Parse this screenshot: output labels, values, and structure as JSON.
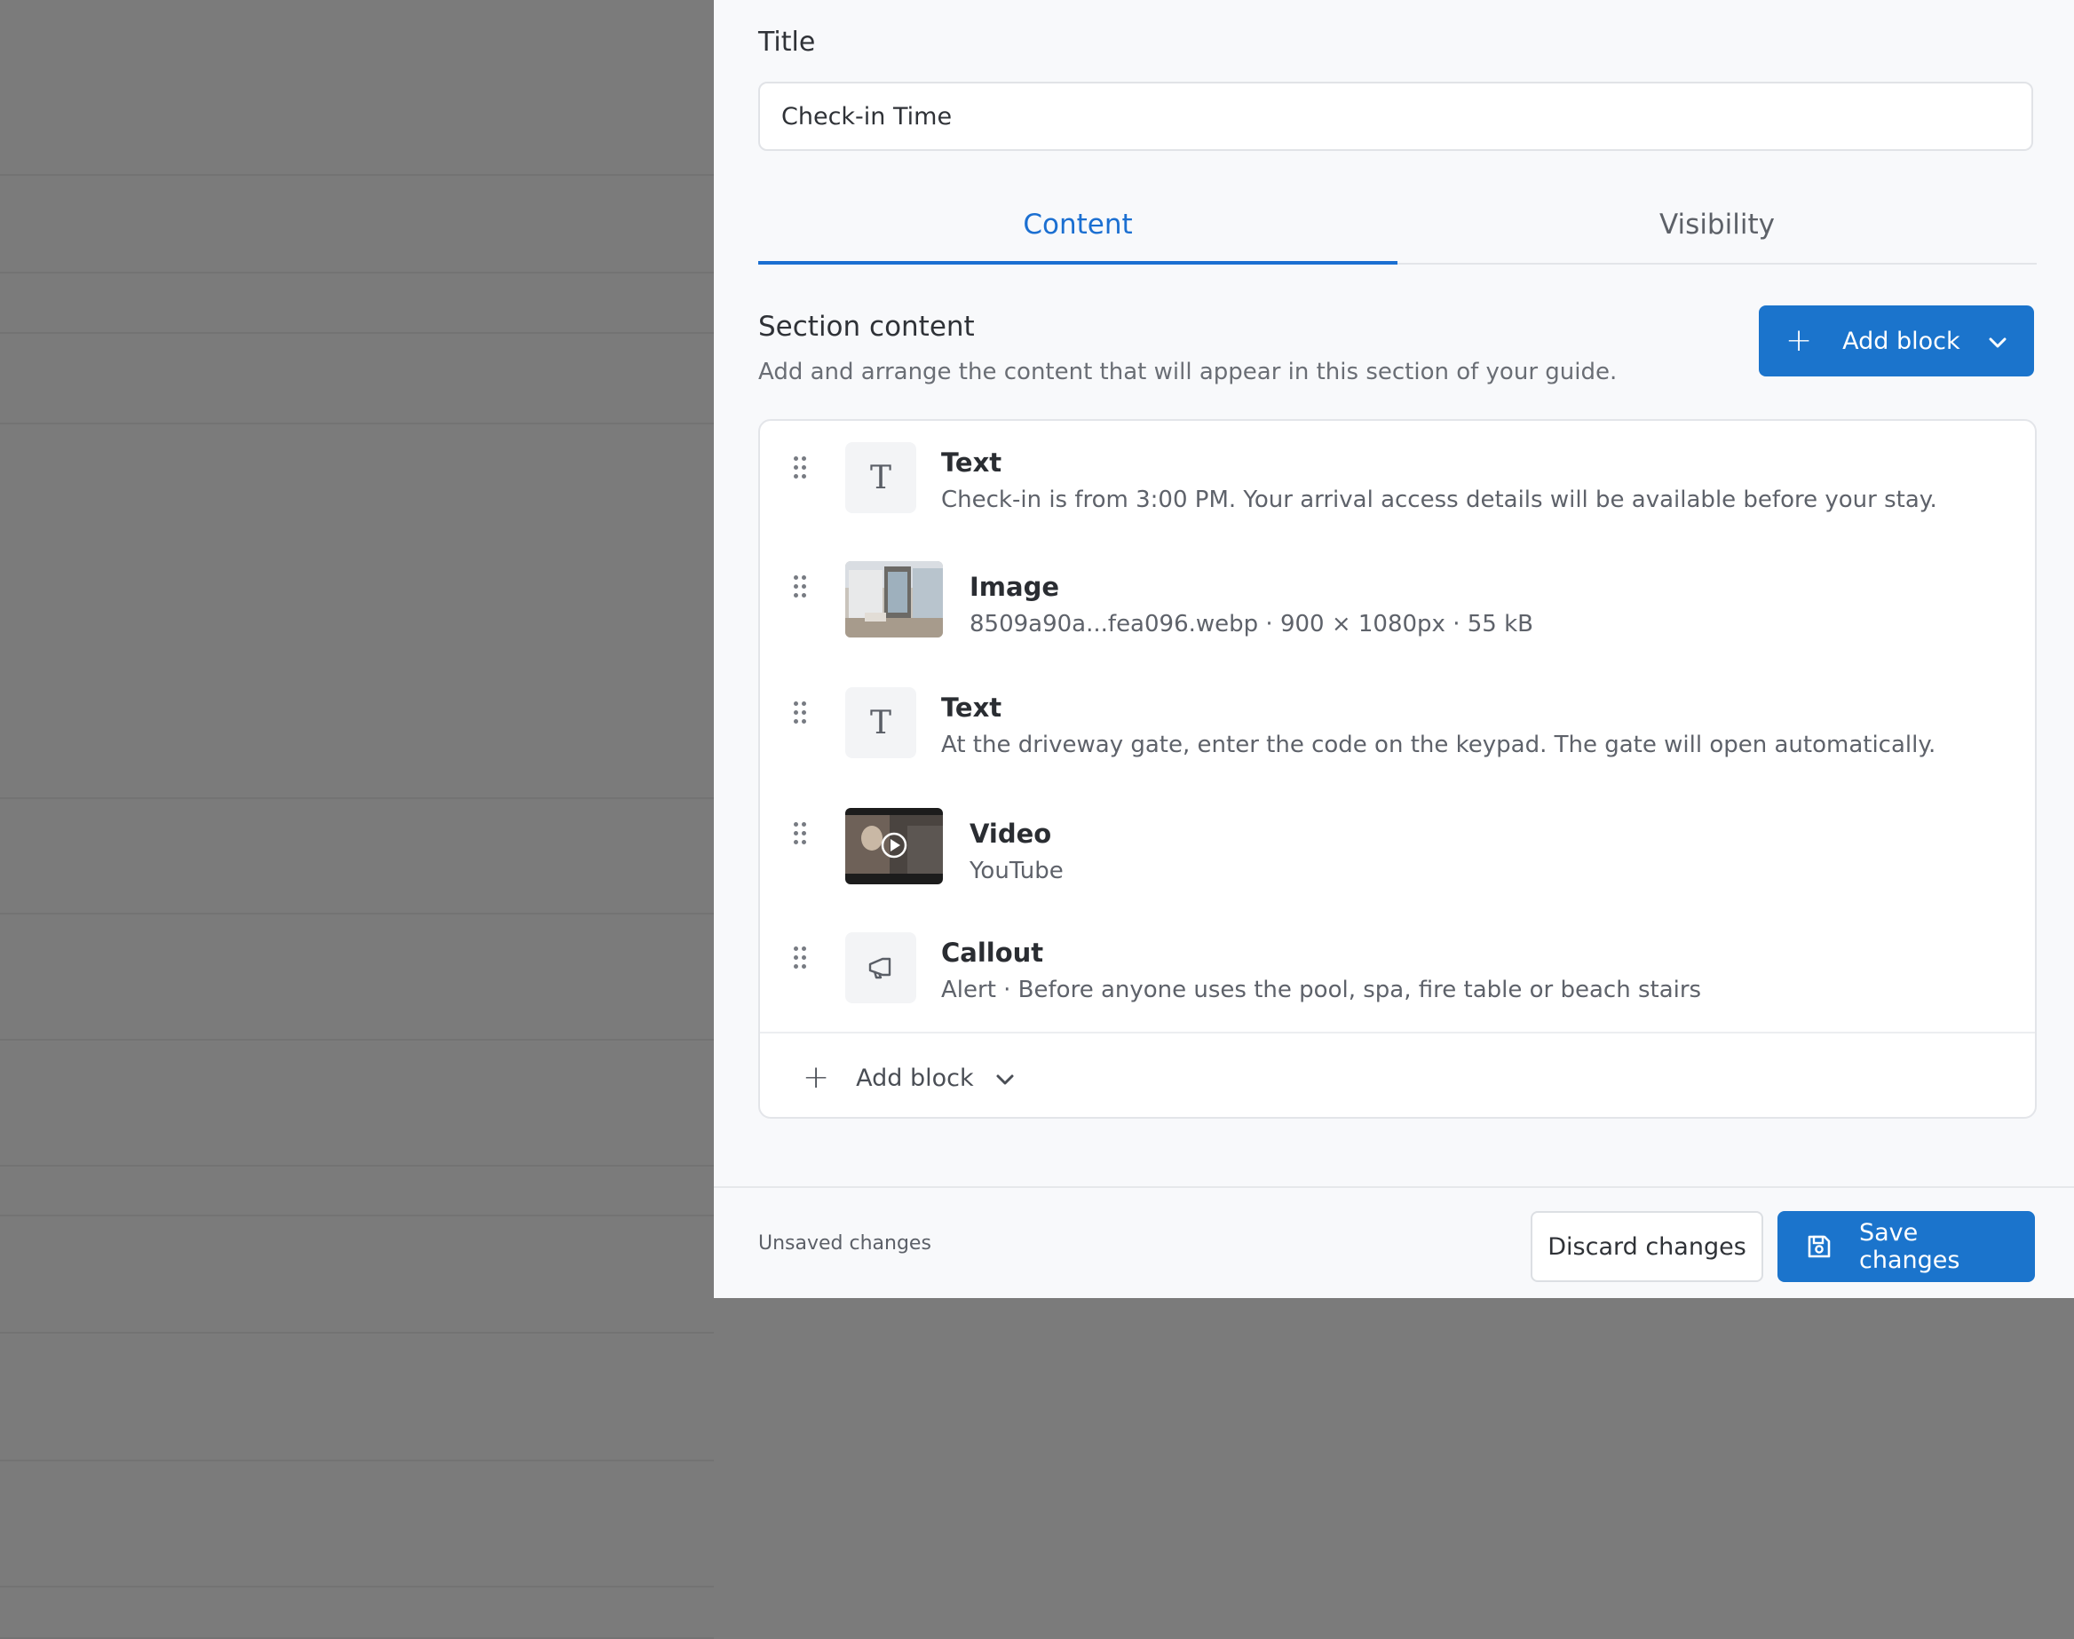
{
  "form": {
    "title_label": "Title",
    "title_value": "Check-in Time"
  },
  "tabs": [
    {
      "label": "Content",
      "active": true
    },
    {
      "label": "Visibility",
      "active": false
    }
  ],
  "section": {
    "title": "Section content",
    "description": "Add and arrange the content that will appear in this section of your guide.",
    "add_block_label": "Add block"
  },
  "blocks": [
    {
      "type": "Text",
      "subtitle": "Check-in is from 3:00 PM. Your arrival access details will be available before your stay.",
      "icon": "text-type-icon"
    },
    {
      "type": "Image",
      "subtitle": "8509a90a...fea096.webp · 900 × 1080px · 55 kB",
      "icon": "image-thumbnail"
    },
    {
      "type": "Text",
      "subtitle": "At the driveway gate, enter the code on the keypad. The gate will open automatically.",
      "icon": "text-type-icon"
    },
    {
      "type": "Video",
      "subtitle": "YouTube",
      "icon": "video-thumbnail"
    },
    {
      "type": "Callout",
      "subtitle": "Alert · Before anyone uses the pool, spa, fire table or beach stairs",
      "icon": "megaphone-icon"
    }
  ],
  "card_footer": {
    "add_block_label": "Add block"
  },
  "footer": {
    "status": "Unsaved changes",
    "discard_label": "Discard changes",
    "save_label": "Save changes"
  },
  "colors": {
    "accent": "#1b74cc",
    "tab_active": "#1b6fd1",
    "overlay": "#7b7b7b"
  }
}
